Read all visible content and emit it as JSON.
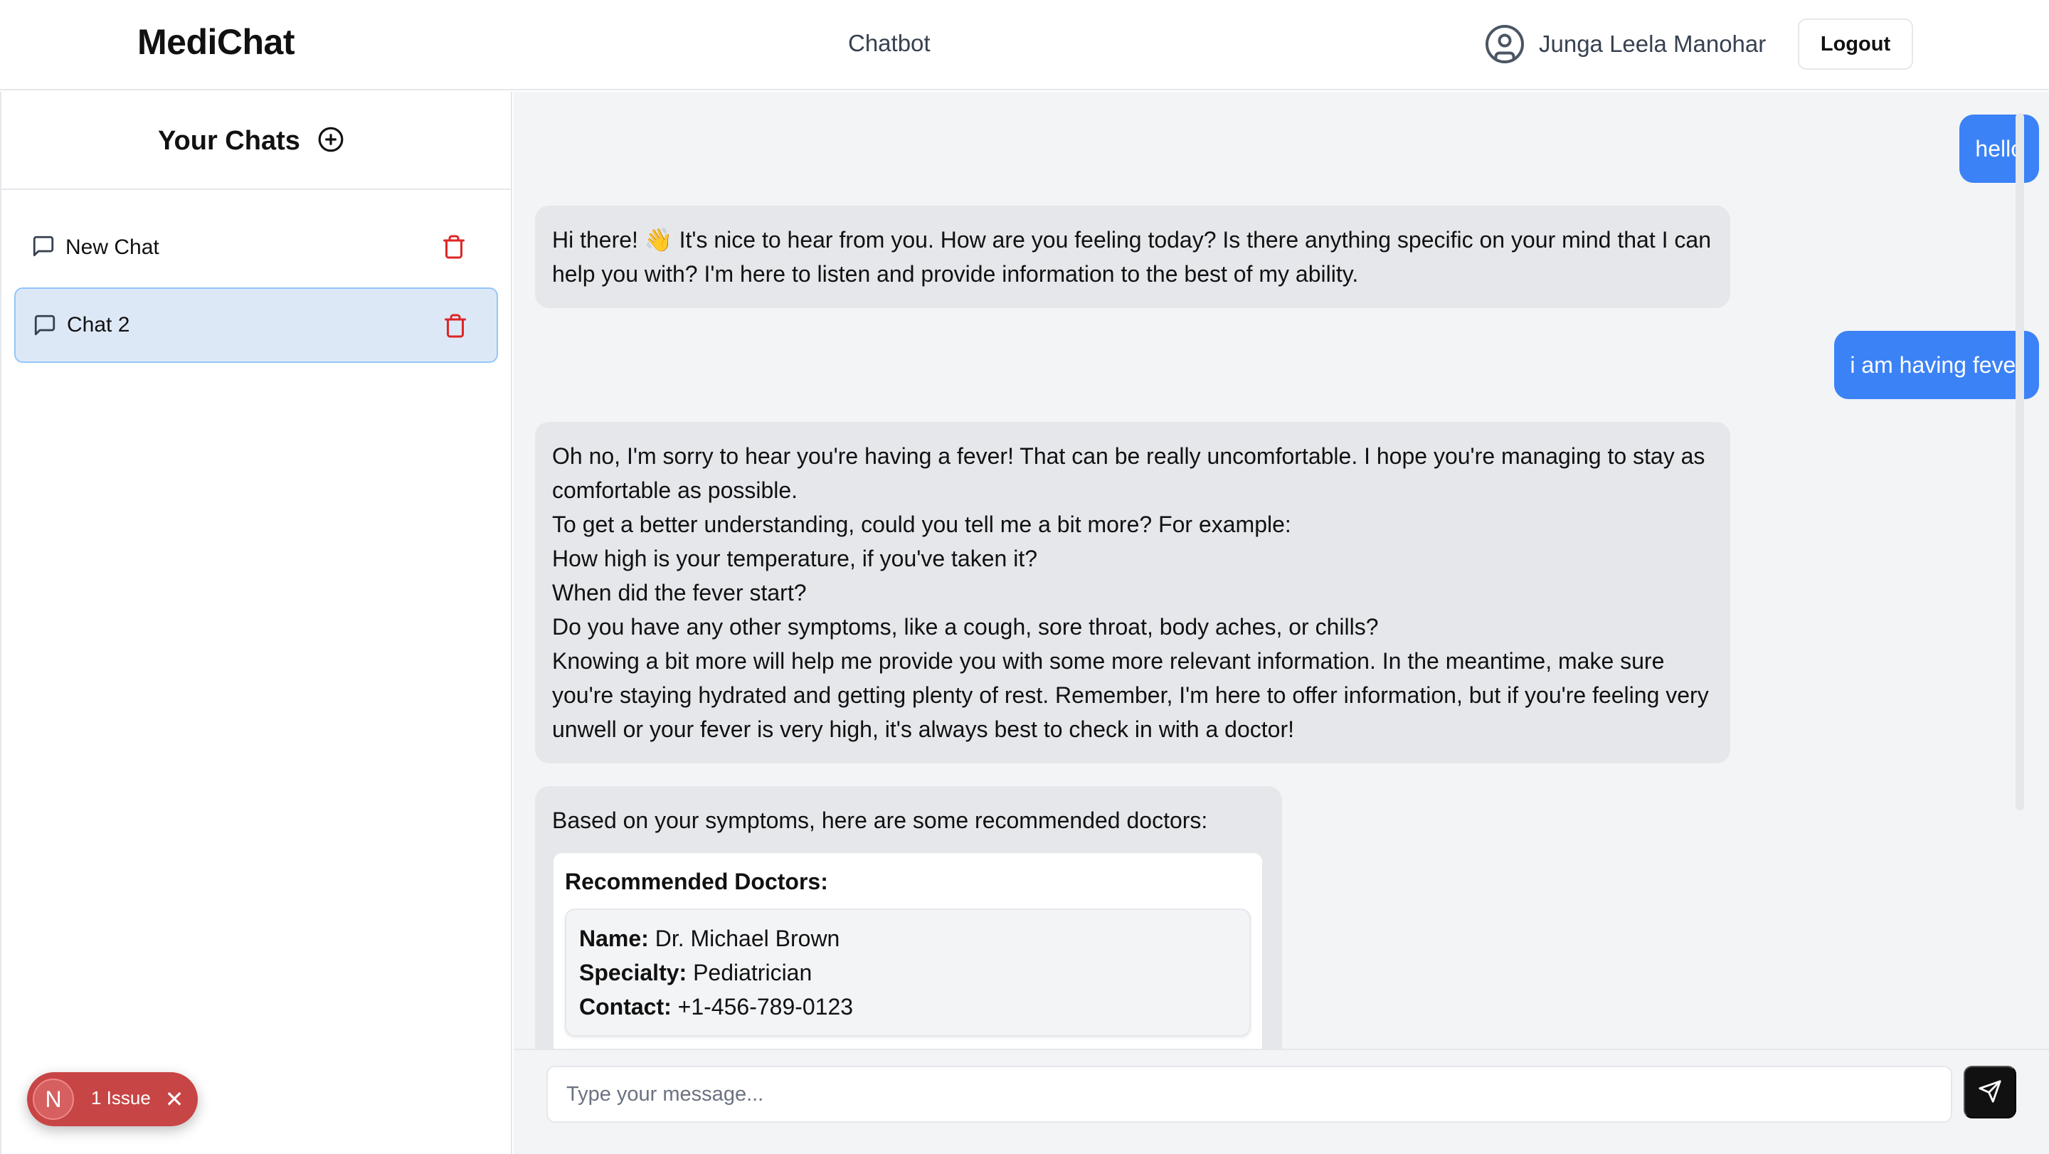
{
  "header": {
    "brand": "MediChat",
    "nav_link": "Chatbot",
    "user_name": "Junga Leela Manohar",
    "logout_label": "Logout"
  },
  "sidebar": {
    "title": "Your Chats",
    "chats": [
      {
        "label": "New Chat",
        "active": false
      },
      {
        "label": "Chat 2",
        "active": true
      }
    ]
  },
  "issue_badge": {
    "initial": "N",
    "text": "1 Issue",
    "close": "✕"
  },
  "messages": [
    {
      "role": "user",
      "text": "hello"
    },
    {
      "role": "bot",
      "lines": [
        "Hi there! 👋 It's nice to hear from you. How are you feeling today? Is there anything specific on your mind that I can help you with? I'm here to listen and provide information to the best of my ability."
      ]
    },
    {
      "role": "user",
      "text": "i am having fever"
    },
    {
      "role": "bot",
      "lines": [
        "Oh no, I'm sorry to hear you're having a fever! That can be really uncomfortable. I hope you're managing to stay as comfortable as possible.",
        "To get a better understanding, could you tell me a bit more? For example:",
        "How high is your temperature, if you've taken it?",
        "When did the fever start?",
        "Do you have any other symptoms, like a cough, sore throat, body aches, or chills?",
        "Knowing a bit more will help me provide you with some more relevant information. In the meantime, make sure you're staying hydrated and getting plenty of rest. Remember, I'm here to offer information, but if you're feeling very unwell or your fever is very high, it's always best to check in with a doctor!"
      ]
    },
    {
      "role": "bot",
      "intro": "Based on your symptoms, here are some recommended doctors:",
      "card_title": "Recommended Doctors:",
      "doctors": [
        {
          "name_label": "Name:",
          "name": "Dr. Michael Brown",
          "specialty_label": "Specialty:",
          "specialty": "Pediatrician",
          "contact_label": "Contact:",
          "contact": "+1-456-789-0123"
        }
      ]
    }
  ],
  "composer": {
    "placeholder": "Type your message...",
    "value": ""
  },
  "colors": {
    "user_bubble": "#3b82f6",
    "bot_bubble": "#e5e7eb",
    "active_chat": "#dde8f7",
    "trash": "#dc2626",
    "issue_badge": "#c84545"
  },
  "icons": {
    "user": "user-circle-icon",
    "new_chat": "plus-circle-icon",
    "chat": "message-square-icon",
    "delete": "trash-icon",
    "send": "send-icon"
  }
}
